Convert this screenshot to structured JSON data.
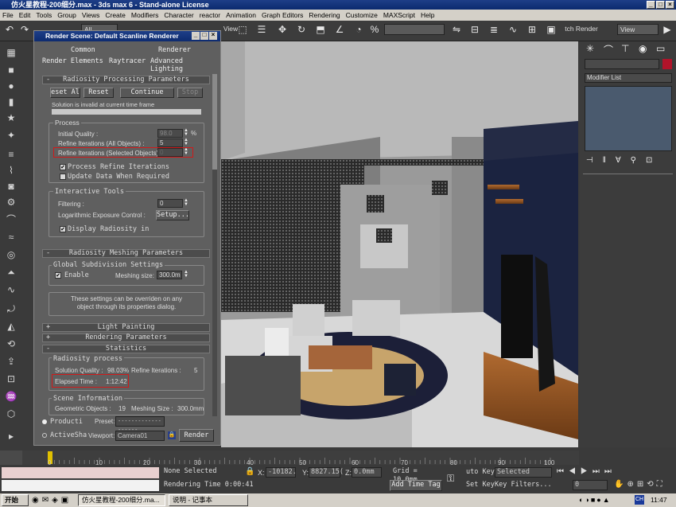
{
  "app": {
    "title": "仿火星教程-200细分.max - 3ds max 6 - Stand-alone License"
  },
  "menu": [
    "File",
    "Edit",
    "Tools",
    "Group",
    "Views",
    "Create",
    "Modifiers",
    "Character",
    "reactor",
    "Animation",
    "Graph Editors",
    "Rendering",
    "Customize",
    "MAXScript",
    "Help"
  ],
  "toolbar": {
    "sel_filter": "All",
    "view1": "View",
    "render_label": "tch Render",
    "view2": "View"
  },
  "dialog": {
    "title": "Render Scene: Default Scanline Renderer",
    "tabs_row1": [
      "Common",
      "Renderer"
    ],
    "tabs_row2": [
      "Render Elements",
      "Raytracer",
      "Advanced Lighting"
    ],
    "radiosity": {
      "header": "Radiosity Processing Parameters",
      "buttons": [
        "eset Al",
        "Reset",
        "Continue",
        "Stop"
      ],
      "solution_text": "Solution is invalid at current time frame",
      "process_label": "Process",
      "initial_quality_label": "Initial Quality :",
      "initial_quality": "98.0",
      "pct": "%",
      "refine_all_label": "Refine Iterations (All Objects) :",
      "refine_all": "5",
      "refine_sel_label": "Refine Iterations (Selected Objects) :",
      "refine_sel": "0",
      "process_refine": "Process Refine Iterations",
      "update_data": "Update Data When Required",
      "interactive_label": "Interactive Tools",
      "filtering_label": "Filtering :",
      "filtering": "0",
      "log_exposure_label": "Logarithmic Exposure Control :",
      "setup_btn": "Setup...",
      "display_radiosity": "Display Radiosity in"
    },
    "meshing": {
      "header": "Radiosity Meshing Parameters",
      "global_label": "Global Subdivision Settings",
      "enable": "Enable",
      "mesh_size_label": "Meshing size:",
      "mesh_size": "300.0m",
      "note": "These settings can be overriden on any object through its properties dialog."
    },
    "light_painting": "Light Painting",
    "rendering_params": "Rendering Parameters",
    "statistics": {
      "header": "Statistics",
      "process_label": "Radiosity process",
      "quality_label": "Solution Quality :",
      "quality": "98.03%",
      "refine_label": "Refine Iterations :",
      "refine": "5",
      "elapsed_label": "Elapsed Time :",
      "elapsed": "1:12:42",
      "scene_label": "Scene Information",
      "geom_label": "Geometric Objects :",
      "geom": "19",
      "meshsize_label": "Meshing Size :",
      "meshsize": "300.0mm"
    },
    "bottom": {
      "production": "Producti",
      "activeshade": "ActiveSha",
      "preset_label": "Preset:",
      "preset": "-------------------",
      "viewport_label": "Viewport:",
      "viewport": "Camera01",
      "render": "Render"
    }
  },
  "rightpanel": {
    "modifier_list": "Modifier List"
  },
  "timeline": {
    "ticks": [
      "0",
      "10",
      "20",
      "30",
      "40",
      "50",
      "60",
      "70",
      "80",
      "90",
      "100"
    ]
  },
  "status": {
    "none_selected": "None Selected",
    "rendering_time": "Rendering Time  0:00:41",
    "x_label": "X:",
    "x": "-10182.",
    "y_label": "Y:",
    "y": "8827.15(",
    "z_label": "Z:",
    "z": "0.0mm",
    "grid": "Grid = 10.0mm",
    "add_time_tag": "Add Time Tag",
    "auto_key": "uto Key",
    "selected": "Selected",
    "set_key": "Set Key",
    "key_filters": "Key Filters...",
    "frame": "0"
  },
  "taskbar": {
    "start": "开始",
    "task1": "仿火星教程-200细分.ma...",
    "task2": "说明 - 记事本",
    "lang": "CH",
    "time": "11:47"
  }
}
